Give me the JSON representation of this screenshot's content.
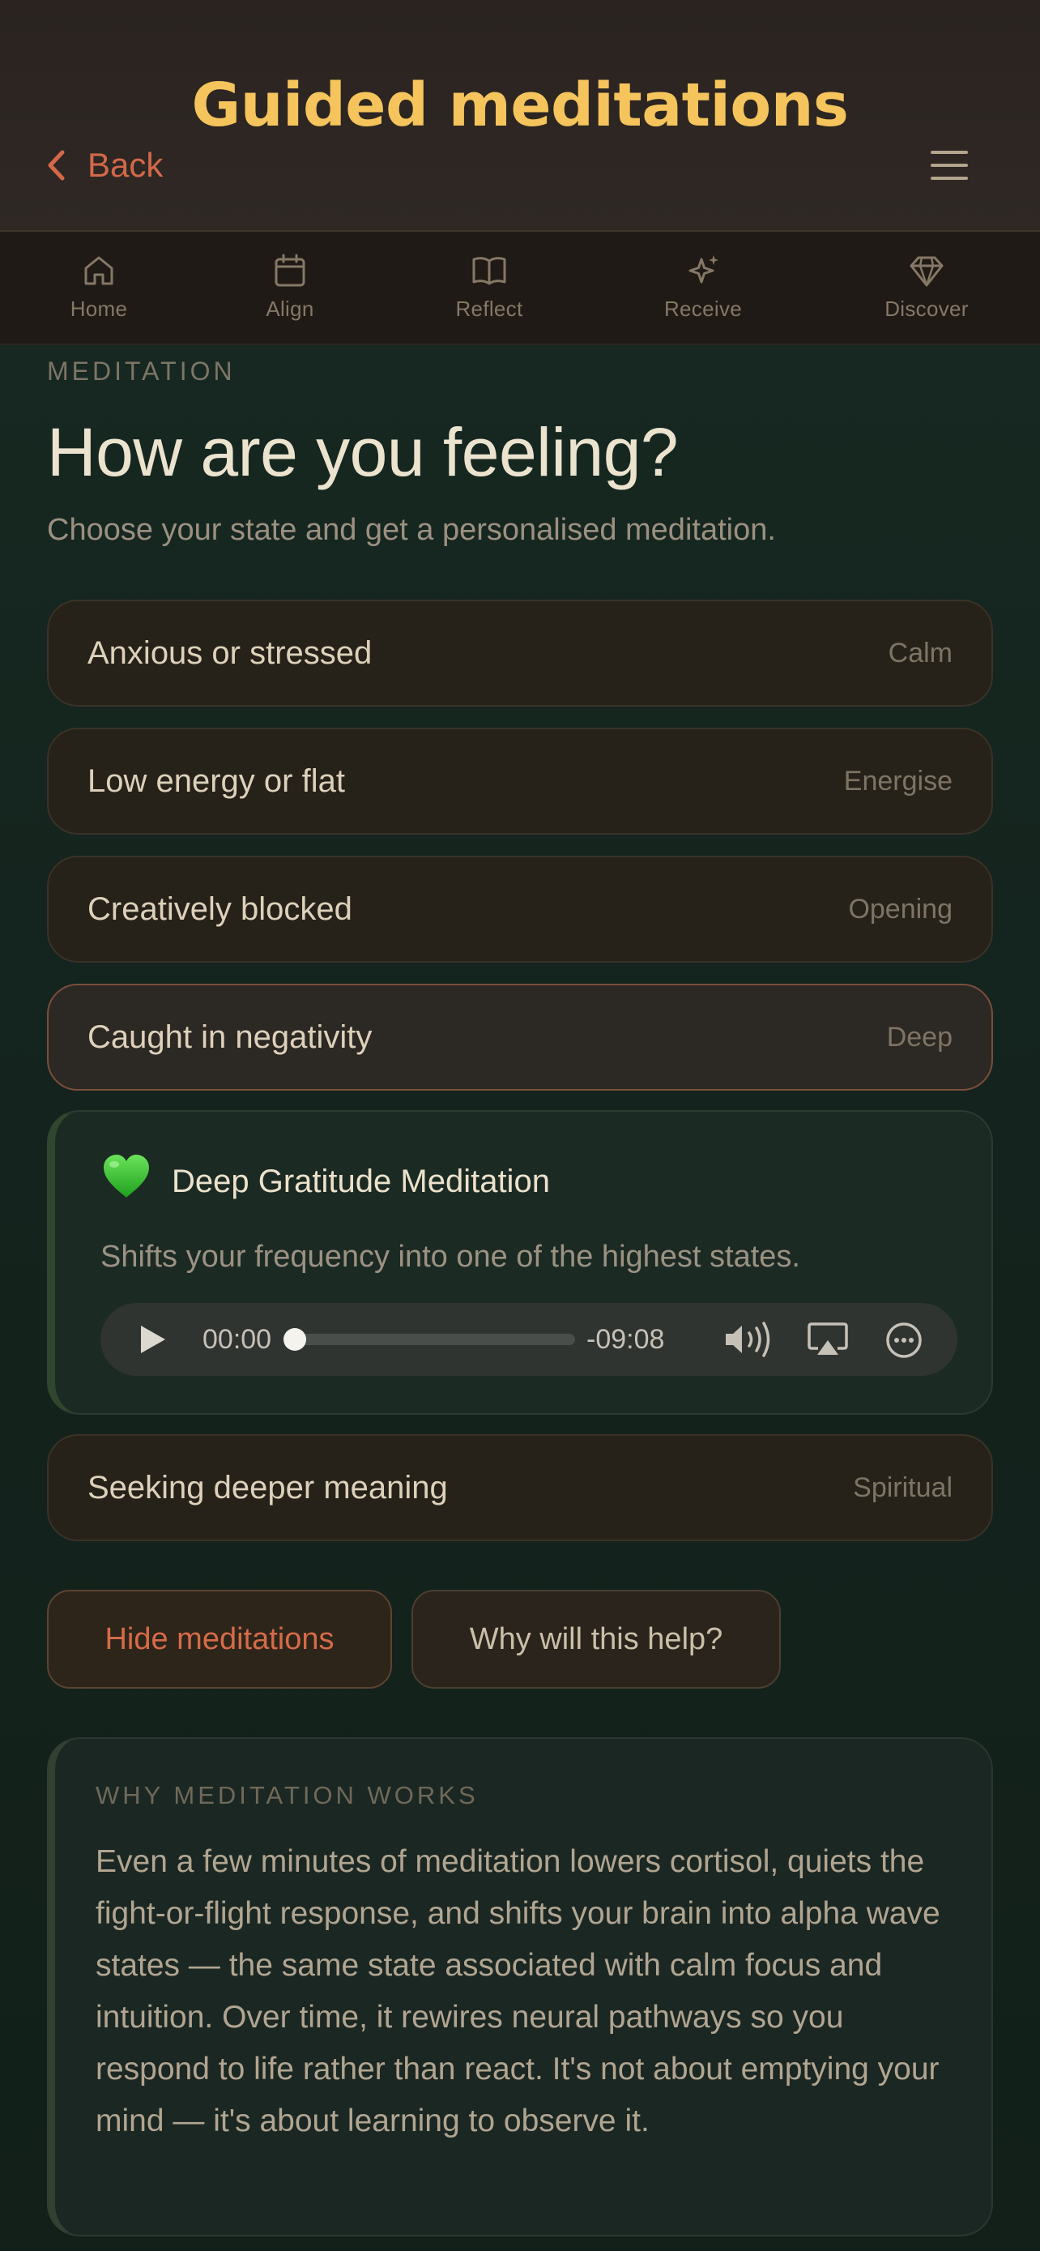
{
  "header": {
    "title": "Guided meditations",
    "back_label": "Back",
    "menu_icon": "hamburger-icon",
    "accent_color": "#f5c45c",
    "back_color": "#d3694a"
  },
  "nav": {
    "tabs": [
      {
        "label": "Home",
        "icon": "home-icon"
      },
      {
        "label": "Align",
        "icon": "calendar-icon"
      },
      {
        "label": "Reflect",
        "icon": "book-icon"
      },
      {
        "label": "Receive",
        "icon": "sparkles-icon"
      },
      {
        "label": "Discover",
        "icon": "diamond-icon"
      }
    ]
  },
  "intro": {
    "eyebrow": "MEDITATION",
    "title": "How are you feeling?",
    "subtitle": "Choose your state and get a personalised meditation."
  },
  "options": [
    {
      "label": "Anxious or stressed",
      "tag": "Calm",
      "selected": false
    },
    {
      "label": "Low energy or flat",
      "tag": "Energise",
      "selected": false
    },
    {
      "label": "Creatively blocked",
      "tag": "Opening",
      "selected": false
    },
    {
      "label": "Caught in negativity",
      "tag": "Deep",
      "selected": true
    },
    {
      "label": "Seeking deeper meaning",
      "tag": "Spiritual",
      "selected": false
    }
  ],
  "meditation": {
    "icon": "green-heart-icon",
    "title": "Deep Gratitude Meditation",
    "description": "Shifts your frequency into one of the highest states.",
    "player": {
      "current_time": "00:00",
      "remaining_time": "-09:08",
      "progress": 0
    }
  },
  "actions": {
    "hide_label": "Hide meditations",
    "why_label": "Why will this help?"
  },
  "info": {
    "eyebrow": "WHY MEDITATION WORKS",
    "body": "Even a few minutes of meditation lowers cortisol, quiets the fight-or-flight response, and shifts your brain into alpha wave states — the same state associated with calm focus and intuition. Over time, it rewires neural pathways so you respond to life rather than react. It's not about emptying your mind — it's about learning to observe it."
  }
}
